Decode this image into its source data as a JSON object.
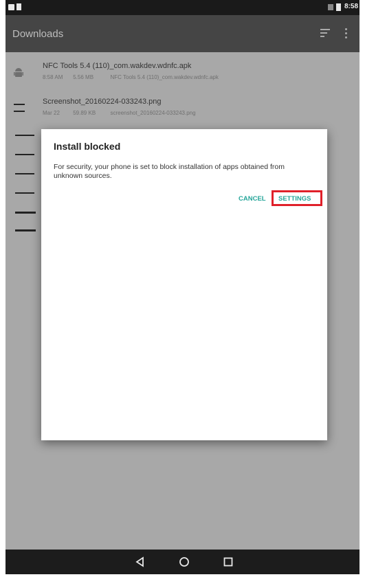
{
  "status_bar": {
    "time": "8:58"
  },
  "app_bar": {
    "title": "Downloads"
  },
  "downloads": [
    {
      "title": "NFC Tools 5.4 (110)_com.wakdev.wdnfc.apk",
      "time": "8:58 AM",
      "size": "5.56 MB",
      "description": "NFC Tools 5.4 (110)_com.wakdev.wdnfc.apk",
      "icon": "android-icon"
    },
    {
      "title": "Screenshot_20160224-033243.png",
      "time": "Mar 22",
      "size": "59.89 KB",
      "description": "screenshot_20160224-033243.png",
      "icon": "image-icon"
    }
  ],
  "dialog": {
    "title": "Install blocked",
    "message": "For security, your phone is set to block installation of apps obtained from unknown sources.",
    "cancel_label": "CANCEL",
    "settings_label": "SETTINGS"
  },
  "colors": {
    "accent": "#26a69a",
    "highlight": "#e0202a",
    "app_bar": "#454545",
    "status_bar": "#1a1a1a"
  }
}
